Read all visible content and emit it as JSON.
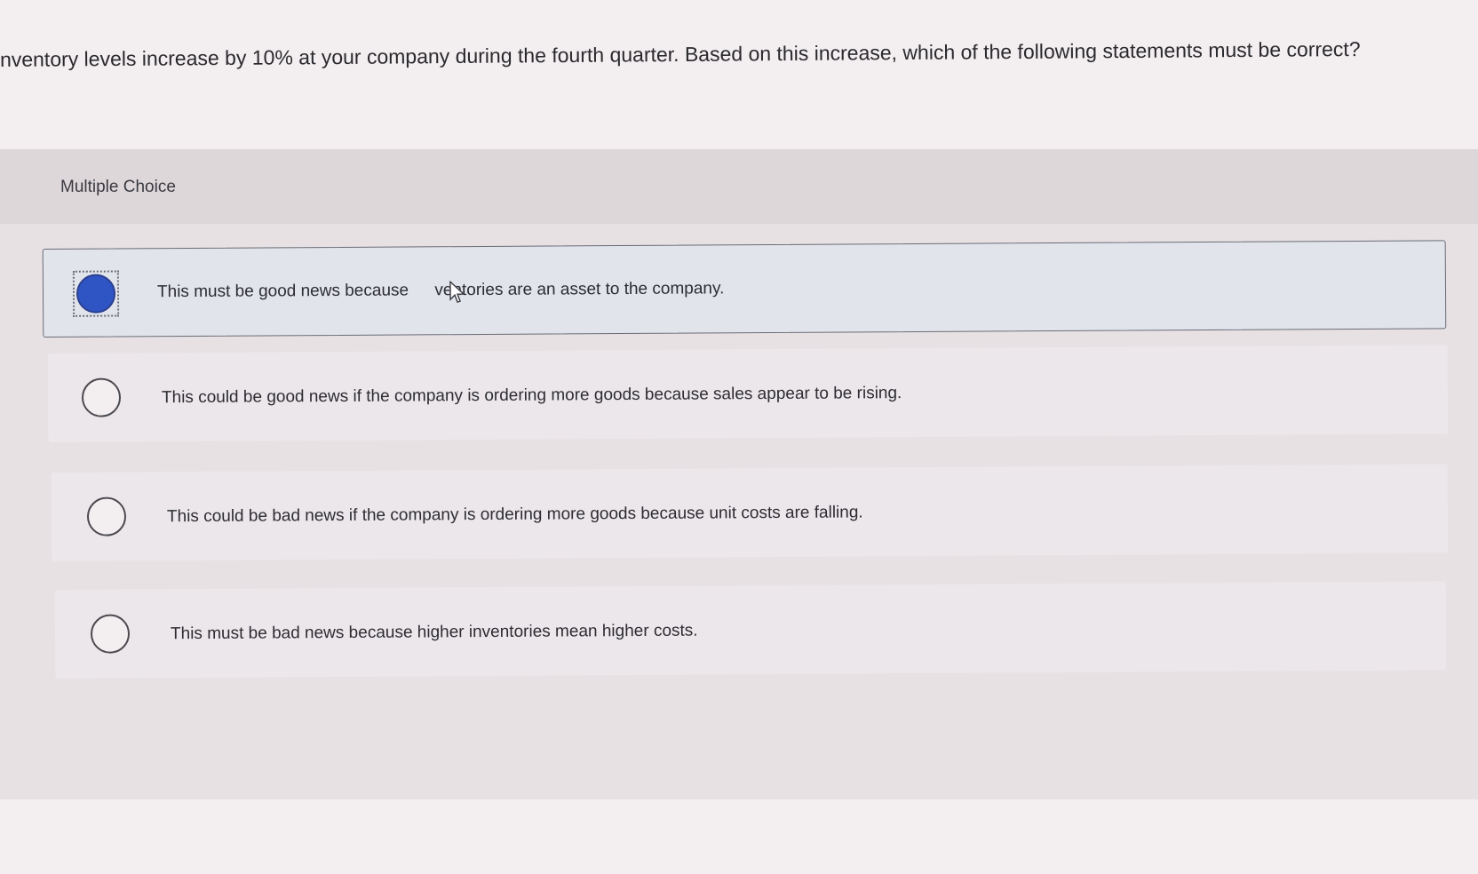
{
  "question": {
    "text": "nventory levels increase by 10% at your company during the fourth quarter. Based on this increase, which of the following statements must be correct?"
  },
  "section": {
    "label": "Multiple Choice"
  },
  "options": [
    {
      "text_before": "This must be good news because ",
      "text_after": "ventories are an asset to the company.",
      "selected": true
    },
    {
      "text": "This could be good news if the company is ordering more goods because sales appear to be rising.",
      "selected": false
    },
    {
      "text": "This could be bad news if the company is ordering more goods because unit costs are falling.",
      "selected": false
    },
    {
      "text": "This must be bad news because higher inventories mean higher costs.",
      "selected": false
    }
  ],
  "colors": {
    "selected_radio": "#2f55c4",
    "selected_option_bg": "#e2e4ec",
    "page_bg": "#f3eef0"
  },
  "icons": {
    "cursor": "mouse-pointer-icon"
  }
}
